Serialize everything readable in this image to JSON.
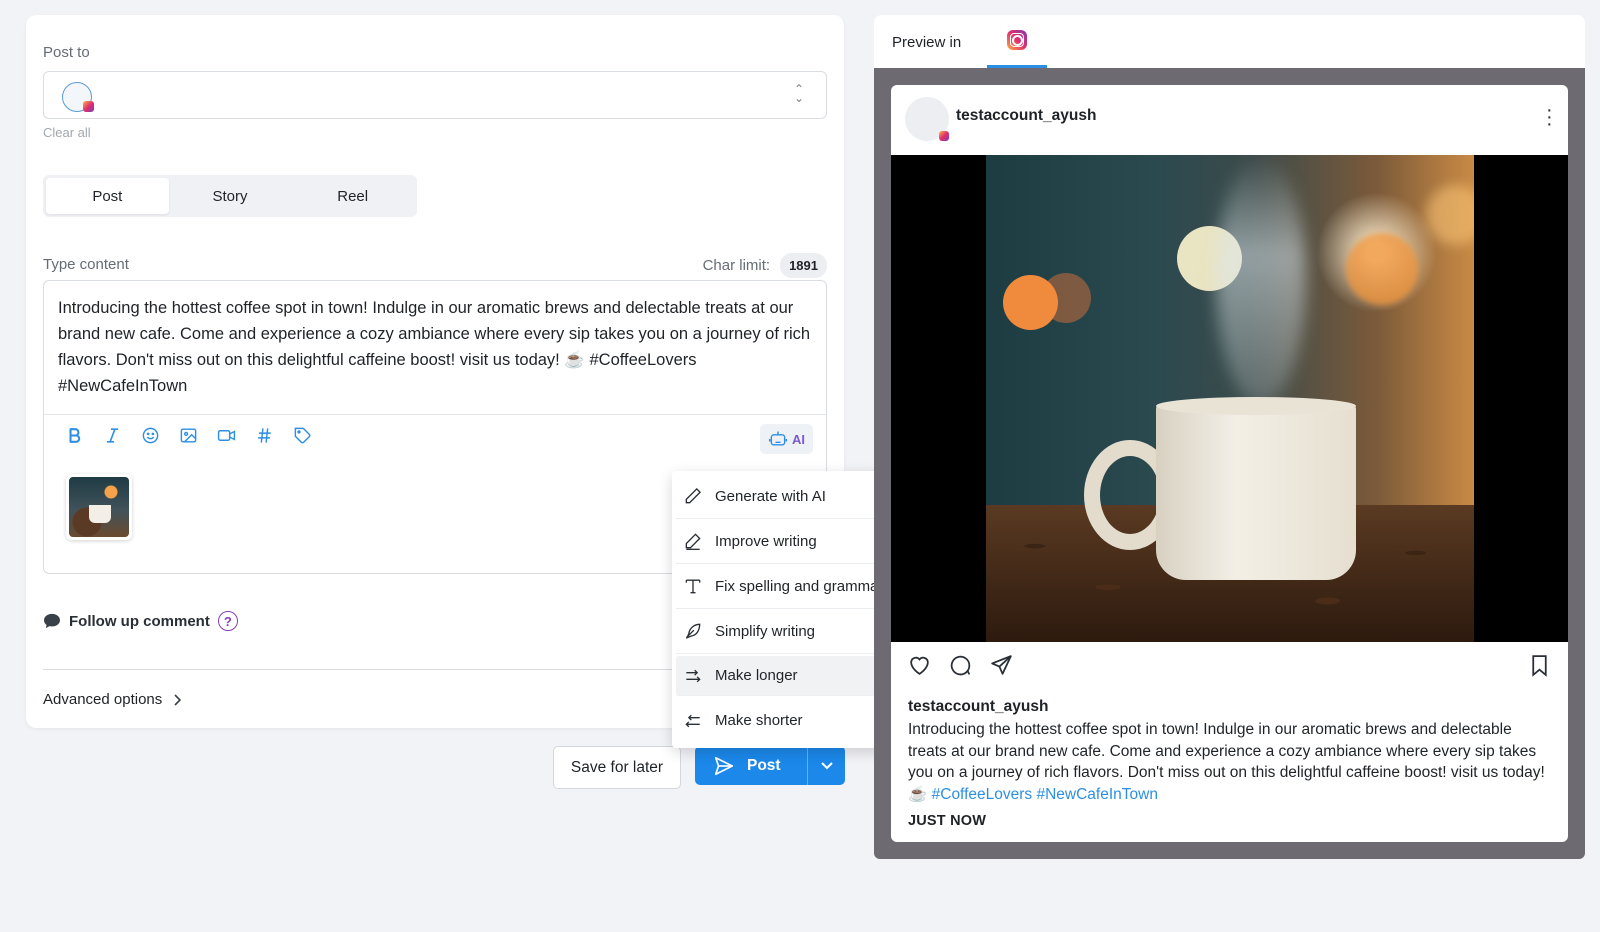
{
  "composer": {
    "post_to_label": "Post to",
    "clear_all": "Clear all",
    "post_types": [
      "Post",
      "Story",
      "Reel"
    ],
    "active_post_type": "Post",
    "type_content_label": "Type content",
    "char_limit_label": "Char limit:",
    "char_limit_value": "1891",
    "content_text": "Introducing the hottest coffee spot in town! Indulge in our aromatic brews and delectable treats at our brand new cafe. Come and experience a cozy ambiance where every sip takes you on a journey of rich flavors. Don't miss out on this delightful caffeine boost! visit us today! ☕ #CoffeeLovers #NewCafeInTown",
    "ai_label": "AI",
    "follow_up_label": "Follow up comment",
    "help_glyph": "?",
    "advanced_options": "Advanced options"
  },
  "toolbar_icons": [
    "bold-icon",
    "italic-icon",
    "emoji-icon",
    "image-icon",
    "video-icon",
    "hashtag-icon",
    "tag-icon"
  ],
  "ai_menu": {
    "items": [
      {
        "label": "Generate with AI",
        "icon": "pencil-icon"
      },
      {
        "label": "Improve writing",
        "icon": "pen-icon"
      },
      {
        "label": "Fix spelling and grammar",
        "icon": "text-icon"
      },
      {
        "label": "Simplify writing",
        "icon": "feather-icon"
      },
      {
        "label": "Make longer",
        "icon": "expand-arrow-icon"
      },
      {
        "label": "Make shorter",
        "icon": "shrink-arrow-icon"
      }
    ],
    "hovered": "Make longer"
  },
  "footer": {
    "save_later": "Save for later",
    "post": "Post"
  },
  "preview": {
    "title": "Preview in",
    "username": "testaccount_ayush",
    "caption_text": "Introducing the hottest coffee spot in town! Indulge in our aromatic brews and delectable treats at our brand new cafe. Come and experience a cozy ambiance where every sip takes you on a journey of rich flavors. Don't miss out on this delightful caffeine boost! visit us today! ☕",
    "caption_tags": "#CoffeeLovers #NewCafeInTown",
    "timestamp": "JUST NOW"
  },
  "colors": {
    "accent_blue": "#1b88ea",
    "ai_purple": "#7b5ad0",
    "preview_bg": "#6e6a72"
  }
}
